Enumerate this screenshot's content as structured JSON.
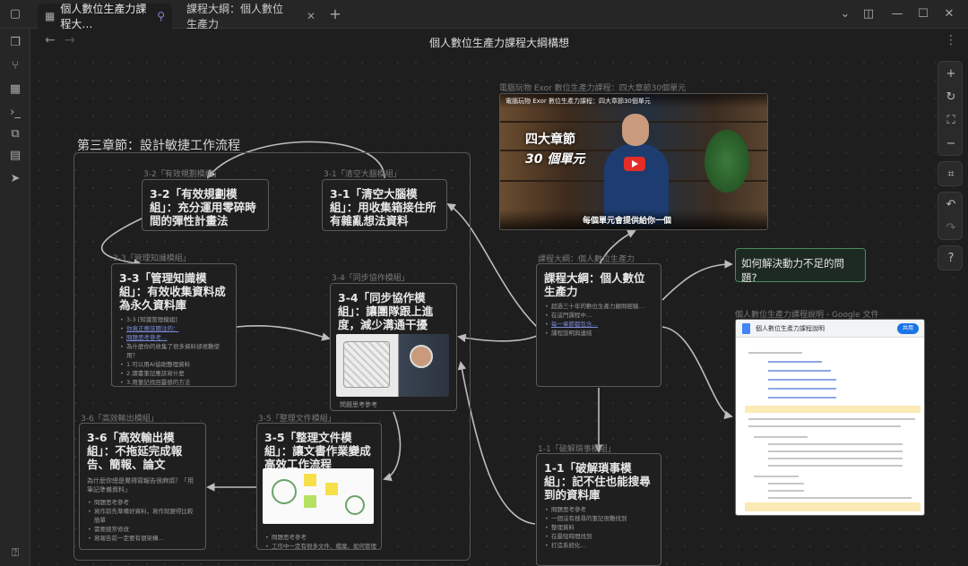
{
  "titlebar": {
    "tabs": [
      {
        "label": "個人數位生產力課程大…",
        "active": true
      },
      {
        "label": "課程大綱：個人數位生產力",
        "active": false
      }
    ],
    "new_tab": "+",
    "min": "—",
    "max": "☐",
    "close": "✕"
  },
  "header": {
    "title": "個人數位生產力課程大綱構想",
    "back": "←",
    "forward": "→",
    "more": "⋮"
  },
  "canvas": {
    "group_label": "第三章節：設計敏捷工作流程",
    "nodes": {
      "n32": {
        "label": "3-2「有效規劃模組」",
        "title": "3-2「有效規劃模組」：充分運用零碎時間的彈性計畫法"
      },
      "n31": {
        "label": "3-1「清空大腦模組」",
        "title": "3-1「清空大腦模組」：用收集箱接住所有雜亂想法資料"
      },
      "n33": {
        "label": "3-3「管理知識模組」",
        "title": "3-3「管理知識模組」：有效收集資料成為永久資料庫",
        "small": "問題思考參考",
        "items": [
          "3-3 [知識管理模組]",
          "你真正應該關注的：",
          "問題思考參考…",
          "為什麼你的收集了很多資料卻很難使用？",
          "1.可以用AI協助整理資料",
          "2.讀書筆記應該寫什麼",
          "3.用筆記找回靈感的方法"
        ]
      },
      "n34": {
        "label": "3-4「同步協作模組」",
        "title": "3-4「同步協作模組」：讓團隊跟上進度，減少溝通干擾",
        "small": "問題思考參考"
      },
      "n36": {
        "label": "3-6「高效輸出模組」",
        "title": "3-6「高效輸出模組」：不拖延完成報告、簡報、論文",
        "small": "為什麼你總是覺得寫報告很麻煩？「用筆記準備資料」",
        "items": [
          "問題思考參考",
          "寫作前先準備好資料，寫作就變得比較簡單",
          "需要經常修改",
          "寫報告前一定要有個架構…"
        ]
      },
      "n35": {
        "label": "3-5「整理文件模組」",
        "title": "3-5「整理文件模組」：讓文書作業變成高效工作流程",
        "items": [
          "問題思考參考",
          "工作中一定有很多文件、檔案、如何管理"
        ]
      },
      "course": {
        "label": "課程大綱：個人數位生產力",
        "title": "課程大綱：個人數位生產力",
        "items": [
          "超過三十年的數位生產力顧問經驗…",
          "在這門課程中…",
          "每一章節都包含…",
          "課程說明與連結"
        ]
      },
      "n11": {
        "label": "1-1「破解瑣事模組」",
        "title": "1-1「破解瑣事模組」：記不住也能搜尋到的資料庫",
        "items": [
          "問題思考參考",
          "一個沒有搜尋的筆記很難找到",
          "整理資料",
          "在最短時間找到",
          "打造系統化…"
        ]
      }
    },
    "video": {
      "caption": "電腦玩物 Exor 數位生產力課程：四大章節30個單元",
      "line1": "四大章節",
      "line2": "30 個單元",
      "subtitle": "每個單元會提供給你一個"
    },
    "question": "如何解決動力不足的問題?",
    "doc": {
      "label": "個人數位生產力課程說明 - Google 文件",
      "title": "個人數位生產力課程說明",
      "share": "共用"
    }
  },
  "ribbon_icons": [
    "files-icon",
    "graph-icon",
    "canvas-icon",
    "terminal-icon",
    "template-icon",
    "calendar-icon",
    "send-icon",
    "help-icon"
  ],
  "right_tools": [
    "zoom-in-icon",
    "reset-icon",
    "fit-icon",
    "zoom-out-icon",
    "select-icon",
    "undo-icon",
    "redo-icon",
    "help-icon"
  ]
}
